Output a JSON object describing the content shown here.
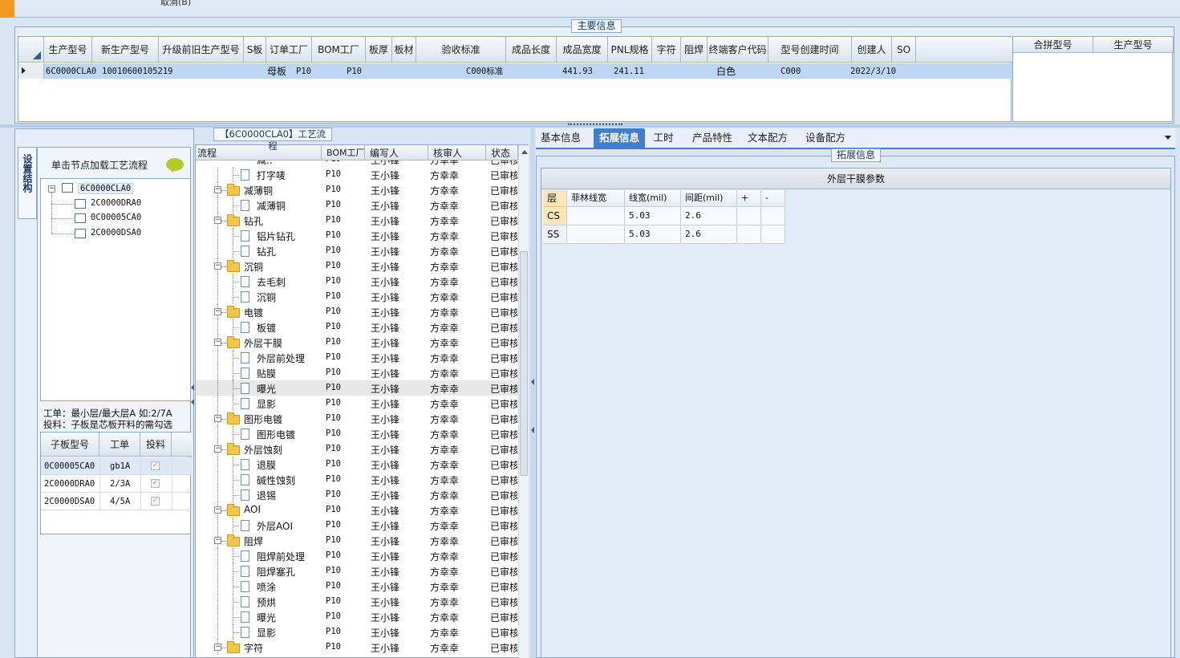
{
  "top": {
    "cut_text": "取消(B)"
  },
  "main_info": {
    "title": "主要信息",
    "columns": [
      "生产型号",
      "新生产型号",
      "升级前旧生产型号",
      "S板",
      "订单工厂",
      "BOM工厂",
      "板厚",
      "板材",
      "验收标准",
      "成品长度",
      "成品宽度",
      "PNL规格",
      "字符",
      "阻焊",
      "终端客户代码",
      "型号创建时间",
      "创建人",
      "SO"
    ],
    "row": {
      "生产型号": "6C0000CLA0",
      "新生产型号": "10010600105219",
      "S板": "母板",
      "订单工厂": "P10",
      "BOM工厂": "P10",
      "验收标准": "C000标准",
      "成品长度": "441.93",
      "成品宽度": "241.11",
      "字符": "白色",
      "终端客户代码": "C000",
      "型号创建时间": "2022/3/10"
    },
    "side_columns": [
      "合拼型号",
      "生产型号"
    ]
  },
  "structure": {
    "vtab_label": "设置结构",
    "hint": "单击节点加载工艺流程",
    "root": "6C0000CLA0",
    "children": [
      "2C0000DRA0",
      "0C00005CA0",
      "2C0000DSA0"
    ],
    "note1": "工单：最小层/最大层A 如:2/7A",
    "note2": "投料：子板是芯板开料的需勾选",
    "sub_columns": [
      "子板型号",
      "工单",
      "投料"
    ],
    "sub_rows": [
      {
        "model": "0C00005CA0",
        "order": "gb1A",
        "check": "✓"
      },
      {
        "model": "2C0000DRA0",
        "order": "2/3A",
        "check": "✓"
      },
      {
        "model": "2C0000DSA0",
        "order": "4/5A",
        "check": "✓"
      }
    ]
  },
  "flow": {
    "title": "【6C0000CLA0】工艺流程",
    "columns": [
      "流程",
      "BOM工厂",
      "编写人",
      "核审人",
      "状态"
    ],
    "partial_top": "减..",
    "rows": [
      {
        "name": "打字唛",
        "folder": false
      },
      {
        "name": "减薄铜",
        "folder": true
      },
      {
        "name": "减薄铜",
        "folder": false
      },
      {
        "name": "钻孔",
        "folder": true
      },
      {
        "name": "铝片钻孔",
        "folder": false
      },
      {
        "name": "钻孔",
        "folder": false
      },
      {
        "name": "沉铜",
        "folder": true
      },
      {
        "name": "去毛刺",
        "folder": false
      },
      {
        "name": "沉铜",
        "folder": false
      },
      {
        "name": "电镀",
        "folder": true
      },
      {
        "name": "板镀",
        "folder": false
      },
      {
        "name": "外层干膜",
        "folder": true
      },
      {
        "name": "外层前处理",
        "folder": false
      },
      {
        "name": "贴膜",
        "folder": false
      },
      {
        "name": "曝光",
        "folder": false,
        "selected": true
      },
      {
        "name": "显影",
        "folder": false
      },
      {
        "name": "图形电镀",
        "folder": true
      },
      {
        "name": "图形电镀",
        "folder": false
      },
      {
        "name": "外层蚀刻",
        "folder": true
      },
      {
        "name": "退膜",
        "folder": false
      },
      {
        "name": "碱性蚀刻",
        "folder": false
      },
      {
        "name": "退锡",
        "folder": false
      },
      {
        "name": "AOI",
        "folder": true
      },
      {
        "name": "外层AOI",
        "folder": false
      },
      {
        "name": "阻焊",
        "folder": true
      },
      {
        "name": "阻焊前处理",
        "folder": false
      },
      {
        "name": "阻焊塞孔",
        "folder": false
      },
      {
        "name": "喷涂",
        "folder": false
      },
      {
        "name": "预烘",
        "folder": false
      },
      {
        "name": "曝光",
        "folder": false
      },
      {
        "name": "显影",
        "folder": false
      },
      {
        "name": "字符",
        "folder": true
      }
    ],
    "bom": "P10",
    "writer": "王小锋",
    "reviewer": "方幸幸",
    "status": "已审核"
  },
  "tabs": [
    "基本信息",
    "拓展信息",
    "工时",
    "产品特性",
    "文本配方",
    "设备配方"
  ],
  "ext": {
    "title": "拓展信息",
    "table_title": "外层干膜参数",
    "columns": [
      "层",
      "菲林线宽",
      "线宽(mil)",
      "间距(mil)",
      "+",
      "-"
    ],
    "rows": [
      {
        "layer": "CS",
        "film": "",
        "width": "5.03",
        "spacing": "2.6"
      },
      {
        "layer": "SS",
        "film": "",
        "width": "5.03",
        "spacing": "2.6"
      }
    ]
  }
}
